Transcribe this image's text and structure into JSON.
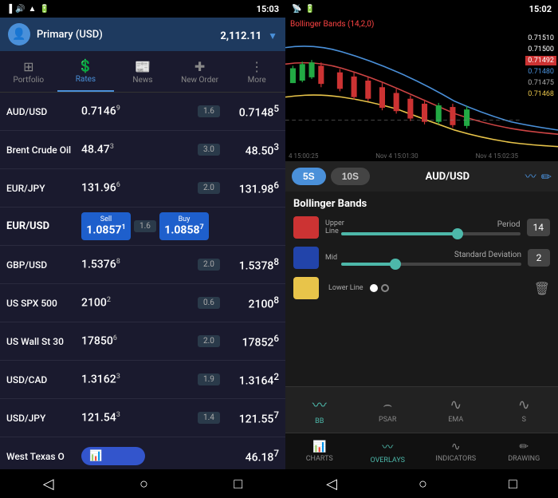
{
  "left": {
    "statusBar": {
      "time": "15:03",
      "icons": "📶 🔋"
    },
    "account": {
      "name": "Primary (USD)",
      "balance": "2,112.11",
      "currency": "▼"
    },
    "nav": [
      {
        "id": "portfolio",
        "label": "Portfolio",
        "icon": "⊞",
        "active": false
      },
      {
        "id": "rates",
        "label": "Rates",
        "icon": "💲",
        "active": true
      },
      {
        "id": "news",
        "label": "News",
        "icon": "📰",
        "active": false
      },
      {
        "id": "new-order",
        "label": "New Order",
        "icon": "✚",
        "active": false
      },
      {
        "id": "more",
        "label": "More",
        "icon": "⋮",
        "active": false
      }
    ],
    "rates": [
      {
        "name": "AUD/USD",
        "bid": "0.7146",
        "bidSup": "9",
        "change": "1.6",
        "ask": "0.7148",
        "askSup": "5",
        "bold": false
      },
      {
        "name": "Brent Crude Oil",
        "bid": "48.47",
        "bidSup": "3",
        "change": "3.0",
        "ask": "48.50",
        "askSup": "3",
        "bold": false
      },
      {
        "name": "EUR/JPY",
        "bid": "131.96",
        "bidSup": "6",
        "change": "2.0",
        "ask": "131.98",
        "askSup": "6",
        "bold": false
      },
      {
        "name": "EUR/USD",
        "sell": "1.0857",
        "sellSup": "1",
        "change": "1.6",
        "buy": "1.0858",
        "buySup": "7",
        "bold": true,
        "isSellBuy": true
      },
      {
        "name": "GBP/USD",
        "bid": "1.5376",
        "bidSup": "8",
        "change": "2.0",
        "ask": "1.5378",
        "askSup": "8",
        "bold": false
      },
      {
        "name": "US SPX 500",
        "bid": "2100",
        "bidSup": "2",
        "change": "0.6",
        "ask": "2100",
        "askSup": "8",
        "bold": false
      },
      {
        "name": "US Wall St 30",
        "bid": "17850",
        "bidSup": "6",
        "change": "2.0",
        "ask": "17852",
        "askSup": "6",
        "bold": false
      },
      {
        "name": "USD/CAD",
        "bid": "1.3162",
        "bidSup": "3",
        "change": "1.9",
        "ask": "1.3164",
        "askSup": "2",
        "bold": false
      },
      {
        "name": "USD/JPY",
        "bid": "121.54",
        "bidSup": "3",
        "change": "1.4",
        "ask": "121.55",
        "askSup": "7",
        "bold": false
      },
      {
        "name": "West Texas O",
        "mini": true,
        "ask": "46.18",
        "askSup": "7",
        "bold": false
      }
    ],
    "bottomNav": [
      "◁",
      "○",
      "□"
    ]
  },
  "right": {
    "statusBar": {
      "time": "15:02"
    },
    "chart": {
      "title": "Bollinger Bands (14,2,0)",
      "timeLabels": [
        "4 15:00:25",
        "Nov 4 15:01:30",
        "Nov 4 15:02:35"
      ],
      "prices": {
        "top": "0.71510",
        "p2": "0.71500",
        "highlight": "0.71492",
        "p4": "0.71480",
        "p5": "0.71475",
        "p6": "0.71468"
      }
    },
    "timeframes": {
      "active": "5S",
      "inactive": "10S",
      "pair": "AUD/USD"
    },
    "bollinger": {
      "title": "Bollinger Bands",
      "period": {
        "label": "Period",
        "value": "14",
        "fillPercent": 65
      },
      "stdDev": {
        "label": "Standard Deviation",
        "value": "2",
        "fillPercent": 30
      },
      "lines": {
        "upper": "Upper Line",
        "mid": "Mid",
        "lower": "Lower Line"
      }
    },
    "indicatorTabs": [
      {
        "id": "bb",
        "label": "BB",
        "icon": "〰",
        "active": true
      },
      {
        "id": "psar",
        "label": "PSAR",
        "icon": "⌢",
        "active": false
      },
      {
        "id": "ema",
        "label": "EMA",
        "icon": "∿",
        "active": false
      },
      {
        "id": "s",
        "label": "S",
        "icon": "∿",
        "active": false
      }
    ],
    "bottomTabs": [
      {
        "id": "charts",
        "label": "CHARTS",
        "icon": "📊",
        "active": false
      },
      {
        "id": "overlays",
        "label": "OVERLAYS",
        "icon": "〰",
        "active": true
      },
      {
        "id": "indicators",
        "label": "INDICATORS",
        "icon": "∿",
        "active": false
      },
      {
        "id": "drawing",
        "label": "DRAWING",
        "icon": "✏",
        "active": false
      }
    ],
    "bottomNav": [
      "◁",
      "○",
      "□"
    ]
  }
}
